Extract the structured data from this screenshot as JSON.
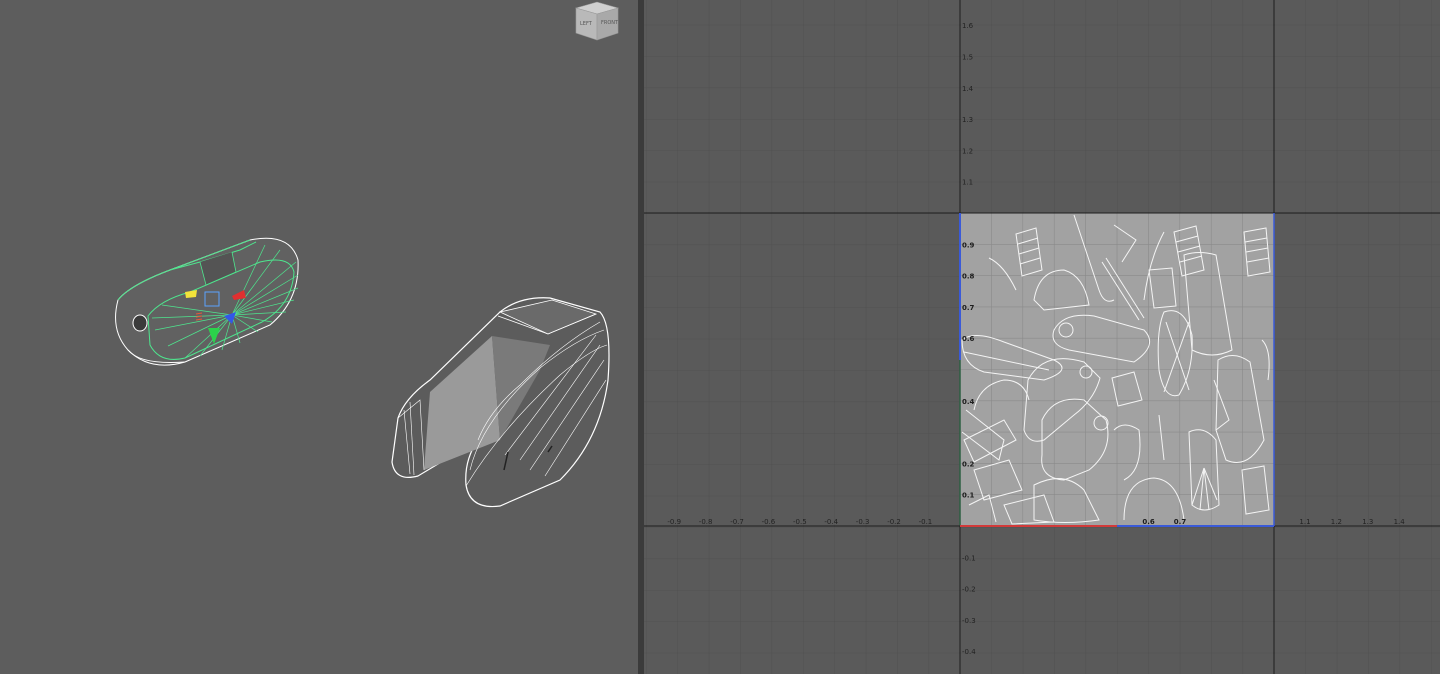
{
  "viewcube": {
    "face_left": "LEFT",
    "face_right": "FRONT"
  },
  "uv_editor": {
    "x_ticks_neg": [
      "-1",
      "-0.9",
      "-0.8",
      "-0.7",
      "-0.6",
      "-0.5",
      "-0.4",
      "-0.3",
      "-0.2",
      "-0.1"
    ],
    "x_ticks_inside": [
      "0.6",
      "0.7"
    ],
    "x_ticks_pos": [
      "1.1",
      "1.2",
      "1.3",
      "1.4"
    ],
    "y_ticks_upper": [
      "1.6",
      "1.5",
      "1.4",
      "1.3",
      "1.2",
      "1.1"
    ],
    "y_ticks_inside": [
      "0.9",
      "0.8",
      "0.7",
      "0.6",
      "0.4",
      "0.2",
      "0.1"
    ],
    "y_ticks_neg": [
      "-0.1",
      "-0.2",
      "-0.3",
      "-0.4"
    ]
  },
  "colors": {
    "uv_tile": "#a2a2a2",
    "selection": "#4ee68e",
    "axis_u": "#d23a3a",
    "axis_v": "#3a5ad8",
    "wire": "#ffffff"
  },
  "icons": [
    "viewcube-icon",
    "move-manipulator-icon",
    "rotate-pivot-icon"
  ]
}
